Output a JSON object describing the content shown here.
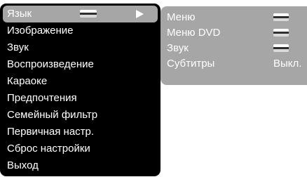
{
  "colors": {
    "main_menu_background": "#000000",
    "selected_highlight": "#a6a6a6",
    "submenu_background": "#a6a6a6",
    "text": "#ffffff"
  },
  "main_menu": {
    "items": [
      {
        "label": "Язык",
        "selected": true,
        "icons": [
          "flag-icon",
          "arrow-right-icon"
        ]
      },
      {
        "label": "Изображение"
      },
      {
        "label": "Звук"
      },
      {
        "label": "Воспроизведение"
      },
      {
        "label": "Караоке"
      },
      {
        "label": "Предпочтения"
      },
      {
        "label": "Семейный фильтр"
      },
      {
        "label": "Первичная настр."
      },
      {
        "label": "Сброс настройки"
      },
      {
        "label": "Выход"
      }
    ]
  },
  "submenu": {
    "items": [
      {
        "label": "Меню",
        "value_icon": "flag-icon"
      },
      {
        "label": "Меню DVD",
        "value_icon": "flag-icon"
      },
      {
        "label": "Звук",
        "value_icon": "flag-icon"
      },
      {
        "label": "Субтитры",
        "value": "Выкл."
      }
    ]
  }
}
